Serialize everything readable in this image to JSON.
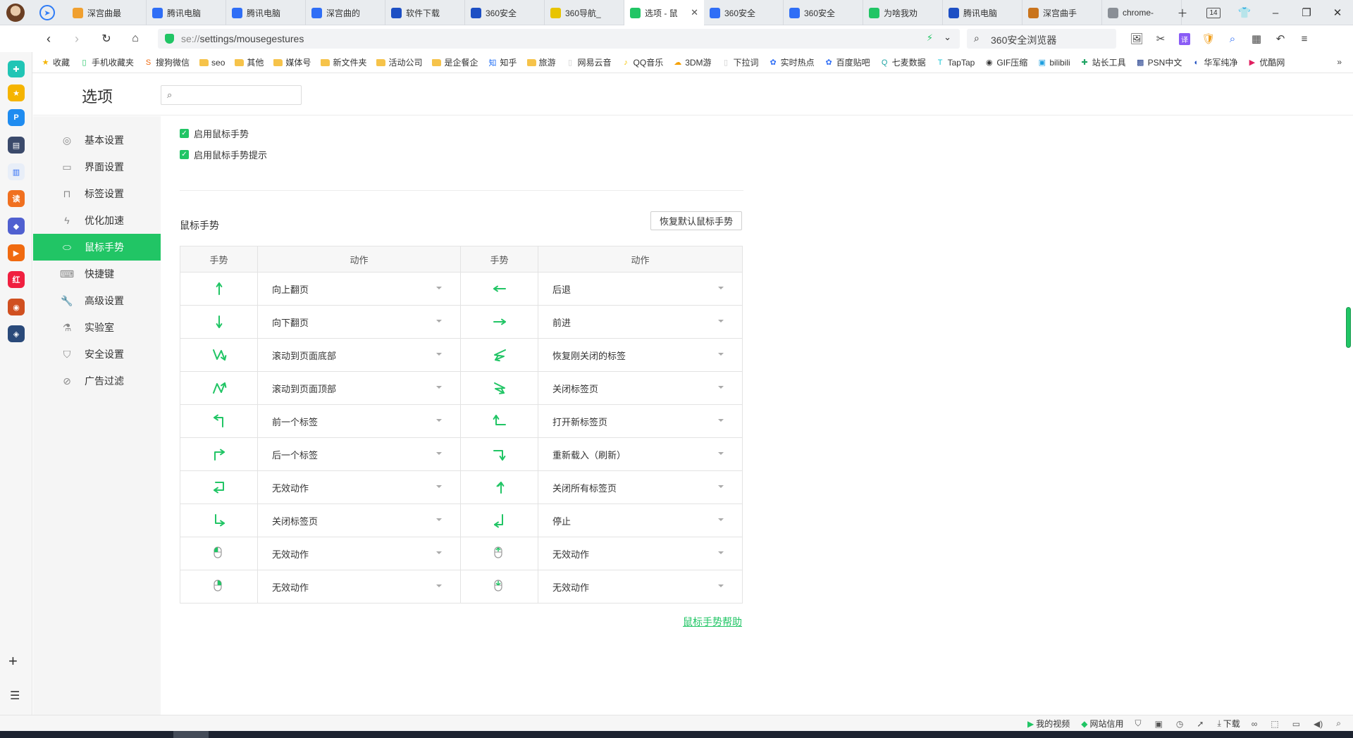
{
  "tabbar": {
    "tabs": [
      {
        "title": "深宫曲最",
        "icon": "web-icon",
        "color": "#f0a030"
      },
      {
        "title": "腾讯电脑",
        "icon": "baidu-paw-icon",
        "color": "#2f6ef6"
      },
      {
        "title": "腾讯电脑",
        "icon": "baidu-paw-icon",
        "color": "#2f6ef6"
      },
      {
        "title": "深宫曲的",
        "icon": "baidu-paw-icon",
        "color": "#2f6ef6"
      },
      {
        "title": "软件下载",
        "icon": "360-icon",
        "color": "#1d4fc4"
      },
      {
        "title": "360安全",
        "icon": "360-icon",
        "color": "#1d4fc4"
      },
      {
        "title": "360导航_",
        "icon": "360-nav-icon",
        "color": "#e8c400"
      },
      {
        "title": "选项 - 鼠",
        "icon": "settings-icon",
        "color": "#21c565",
        "active": true
      },
      {
        "title": "360安全",
        "icon": "baidu-paw-icon",
        "color": "#2f6ef6"
      },
      {
        "title": "360安全",
        "icon": "baidu-paw-icon",
        "color": "#2f6ef6"
      },
      {
        "title": "为啥我劝",
        "icon": "wechat-icon",
        "color": "#21c565"
      },
      {
        "title": "腾讯电脑",
        "icon": "360-icon",
        "color": "#1d4fc4"
      },
      {
        "title": "深宫曲手",
        "icon": "book-icon",
        "color": "#c9741c"
      },
      {
        "title": "chrome-",
        "icon": "image-icon",
        "color": "#8a8f96"
      }
    ],
    "tab_count": "14"
  },
  "addressbar": {
    "url_prefix": "se://",
    "url_main": "settings/mousegestures",
    "search_text": "360安全浏览器"
  },
  "bookmarks": {
    "items": [
      {
        "label": "收藏",
        "icon": "star-icon"
      },
      {
        "label": "手机收藏夹",
        "icon": "phone-icon"
      },
      {
        "label": "搜狗微信",
        "icon": "sogou-icon"
      },
      {
        "label": "seo",
        "icon": "folder-icon"
      },
      {
        "label": "其他",
        "icon": "folder-icon"
      },
      {
        "label": "媒体号",
        "icon": "folder-icon"
      },
      {
        "label": "新文件夹",
        "icon": "folder-icon"
      },
      {
        "label": "活动公司",
        "icon": "folder-icon"
      },
      {
        "label": "是企餐企",
        "icon": "folder-icon"
      },
      {
        "label": "知乎",
        "icon": "zhihu-icon"
      },
      {
        "label": "旅游",
        "icon": "folder-icon"
      },
      {
        "label": "网易云音",
        "icon": "page-icon"
      },
      {
        "label": "QQ音乐",
        "icon": "qqmusic-icon"
      },
      {
        "label": "3DM游",
        "icon": "3dm-icon"
      },
      {
        "label": "下拉词",
        "icon": "page-icon"
      },
      {
        "label": "实时热点",
        "icon": "baidu-paw-icon"
      },
      {
        "label": "百度贴吧",
        "icon": "baidu-paw-icon"
      },
      {
        "label": "七麦数据",
        "icon": "qimai-icon"
      },
      {
        "label": "TapTap",
        "icon": "taptap-icon"
      },
      {
        "label": "GIF压缩",
        "icon": "gif-icon"
      },
      {
        "label": "bilibili",
        "icon": "bilibili-icon"
      },
      {
        "label": "站长工具",
        "icon": "tool-icon"
      },
      {
        "label": "PSN中文",
        "icon": "psn-icon"
      },
      {
        "label": "华军纯净",
        "icon": "huajun-icon"
      },
      {
        "label": "优酷网",
        "icon": "youku-icon"
      }
    ],
    "more": "»"
  },
  "settings": {
    "title": "选项",
    "search_placeholder": "",
    "menu": [
      {
        "label": "基本设置",
        "icon": "target-icon"
      },
      {
        "label": "界面设置",
        "icon": "window-icon"
      },
      {
        "label": "标签设置",
        "icon": "tab-icon"
      },
      {
        "label": "优化加速",
        "icon": "bolt-icon"
      },
      {
        "label": "鼠标手势",
        "icon": "mouse-icon",
        "active": true
      },
      {
        "label": "快捷键",
        "icon": "keyboard-icon"
      },
      {
        "label": "高级设置",
        "icon": "wrench-icon"
      },
      {
        "label": "实验室",
        "icon": "flask-icon"
      },
      {
        "label": "安全设置",
        "icon": "shield-check-icon"
      },
      {
        "label": "广告过滤",
        "icon": "block-icon"
      }
    ],
    "checkboxes": [
      {
        "label": "启用鼠标手势",
        "checked": true
      },
      {
        "label": "启用鼠标手势提示",
        "checked": true
      }
    ],
    "section_title": "鼠标手势",
    "reset_button": "恢复默认鼠标手势",
    "table_headers": [
      "手势",
      "动作",
      "手势",
      "动作"
    ],
    "gestures": [
      {
        "left": {
          "gesture": "up",
          "action": "向上翻页"
        },
        "right": {
          "gesture": "left",
          "action": "后退"
        }
      },
      {
        "left": {
          "gesture": "down",
          "action": "向下翻页"
        },
        "right": {
          "gesture": "right",
          "action": "前进"
        }
      },
      {
        "left": {
          "gesture": "zigzag-down",
          "action": "滚动到页面底部"
        },
        "right": {
          "gesture": "z-shape",
          "action": "恢复刚关闭的标签"
        }
      },
      {
        "left": {
          "gesture": "zigzag-up",
          "action": "滚动到页面顶部"
        },
        "right": {
          "gesture": "reverse-z",
          "action": "关闭标签页"
        }
      },
      {
        "left": {
          "gesture": "up-left",
          "action": "前一个标签"
        },
        "right": {
          "gesture": "left-up",
          "action": "打开新标签页"
        }
      },
      {
        "left": {
          "gesture": "up-right",
          "action": "后一个标签"
        },
        "right": {
          "gesture": "right-down",
          "action": "重新载入（刷新）"
        }
      },
      {
        "left": {
          "gesture": "right-down-left",
          "action": "无效动作"
        },
        "right": {
          "gesture": "down-up",
          "action": "关闭所有标签页"
        }
      },
      {
        "left": {
          "gesture": "down-right",
          "action": "关闭标签页"
        },
        "right": {
          "gesture": "down-left",
          "action": "停止"
        }
      },
      {
        "left": {
          "gesture": "mouse-left-click",
          "action": "无效动作"
        },
        "right": {
          "gesture": "mouse-wheel-up",
          "action": "无效动作"
        }
      },
      {
        "left": {
          "gesture": "mouse-right-click",
          "action": "无效动作"
        },
        "right": {
          "gesture": "mouse-wheel-down",
          "action": "无效动作"
        }
      }
    ],
    "help_link": "鼠标手势帮助"
  },
  "statusbar": {
    "items": [
      {
        "label": "我的视频",
        "icon": "video-icon"
      },
      {
        "label": "网站信用",
        "icon": "drop-icon"
      },
      {
        "label": "",
        "icon": "shield-icon"
      },
      {
        "label": "",
        "icon": "image-icon"
      },
      {
        "label": "",
        "icon": "speed-icon"
      },
      {
        "label": "",
        "icon": "rocket-icon"
      },
      {
        "label": "下载",
        "icon": "download-icon"
      },
      {
        "label": "",
        "icon": "glasses-icon"
      },
      {
        "label": "",
        "icon": "screenshot-icon"
      },
      {
        "label": "",
        "icon": "window-icon"
      },
      {
        "label": "",
        "icon": "volume-icon"
      },
      {
        "label": "",
        "icon": "search-icon"
      }
    ]
  },
  "colors": {
    "accent": "#21c565",
    "menu_bg": "#f5f5f5",
    "tab_bg": "#e9ecef"
  }
}
